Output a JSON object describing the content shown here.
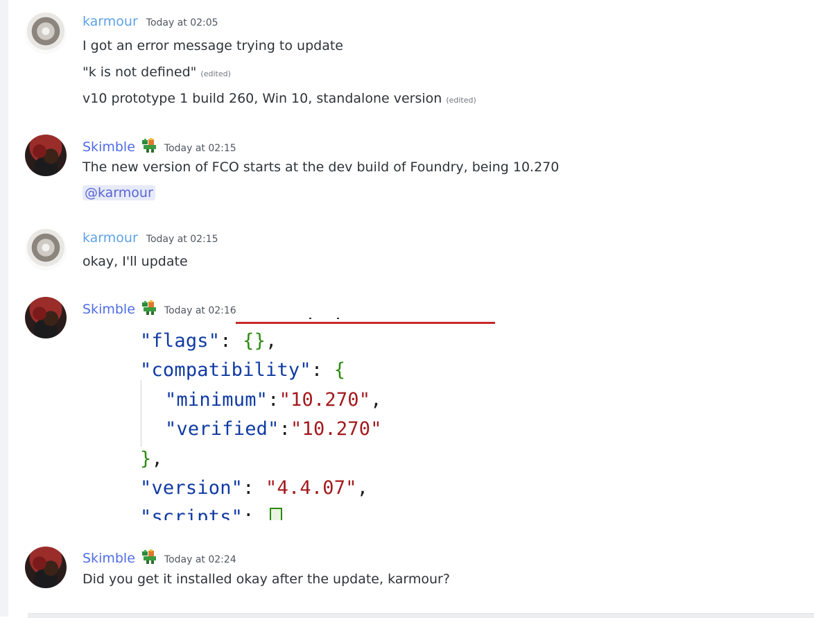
{
  "messages": [
    {
      "user": "karmour",
      "timestamp": "Today at 02:05",
      "lines": [
        {
          "text": "I got an error message trying to update",
          "edited": ""
        },
        {
          "text": "\"k is not defined\"",
          "edited": "(edited)"
        },
        {
          "text": "v10 prototype 1 build 260, Win 10, standalone version",
          "edited": "(edited)"
        }
      ]
    },
    {
      "user": "Skimble",
      "role_icon": "role-badge-icon",
      "timestamp": "Today at 02:15",
      "lines": [
        {
          "text": "The new version of FCO starts at the dev build of Foundry, being 10.270"
        }
      ],
      "mention": "@karmour"
    },
    {
      "user": "karmour",
      "timestamp": "Today at 02:15",
      "lines": [
        {
          "text": "okay, I'll update"
        }
      ]
    },
    {
      "user": "Skimble",
      "role_icon": "role-badge-icon",
      "timestamp": "Today at 02:16",
      "attachment": {
        "type": "code-screenshot",
        "code": {
          "flags_key": "\"flags\"",
          "flags_value": "{}",
          "compat_key": "\"compatibility\"",
          "min_key": "\"minimum\"",
          "min_value": "\"10.270\"",
          "ver_key": "\"verified\"",
          "ver_value": "\"10.270\"",
          "version_key": "\"version\"",
          "version_value": "\"4.4.07\"",
          "scripts_key": "\"scripts\""
        }
      }
    },
    {
      "user": "Skimble",
      "role_icon": "role-badge-icon",
      "timestamp": "Today at 02:24",
      "lines": [
        {
          "text": "Did you get it installed okay after the update, karmour?"
        }
      ]
    }
  ],
  "colors": {
    "karmour_name": "#5ea2e8",
    "skimble_name": "#4f6ce6",
    "mention_bg": "#e7eaf9",
    "code_key": "#0f3aa3",
    "code_string": "#a3191c",
    "code_brace": "#2b8a0e"
  }
}
